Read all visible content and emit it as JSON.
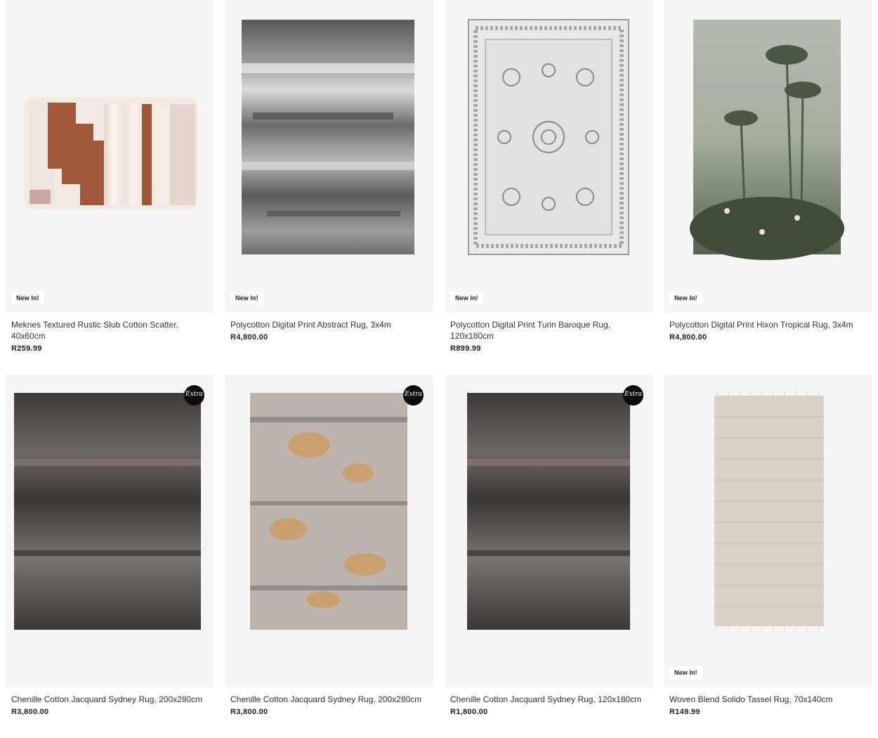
{
  "products": [
    {
      "name": "Meknes Textured Rustic Slub Cotton Scatter, 40x60cm",
      "price": "R259.99",
      "badge": "New In!"
    },
    {
      "name": "Polycotton Digital Print Abstract Rug, 3x4m",
      "price": "R4,800.00",
      "badge": "New In!"
    },
    {
      "name": "Polycotton Digital Print Turin Baroque Rug, 120x180cm",
      "price": "R899.99",
      "badge": "New In!"
    },
    {
      "name": "Polycotton Digital Print Hixon Tropical Rug, 3x4m",
      "price": "R4,800.00",
      "badge": "New In!"
    },
    {
      "name": "Chenille Cotton Jacquard Sydney Rug, 200x280cm",
      "price": "R3,800.00",
      "badge": "Extra"
    },
    {
      "name": "Chenille Cotton Jacquard Sydney Rug, 200x280cm",
      "price": "R3,800.00",
      "badge": "Extra"
    },
    {
      "name": "Chenille Cotton Jacquard Sydney Rug, 120x180cm",
      "price": "R1,800.00",
      "badge": "Extra"
    },
    {
      "name": "Woven Blend Solido Tassel Rug, 70x140cm",
      "price": "R149.99",
      "badge": "New In!"
    }
  ]
}
